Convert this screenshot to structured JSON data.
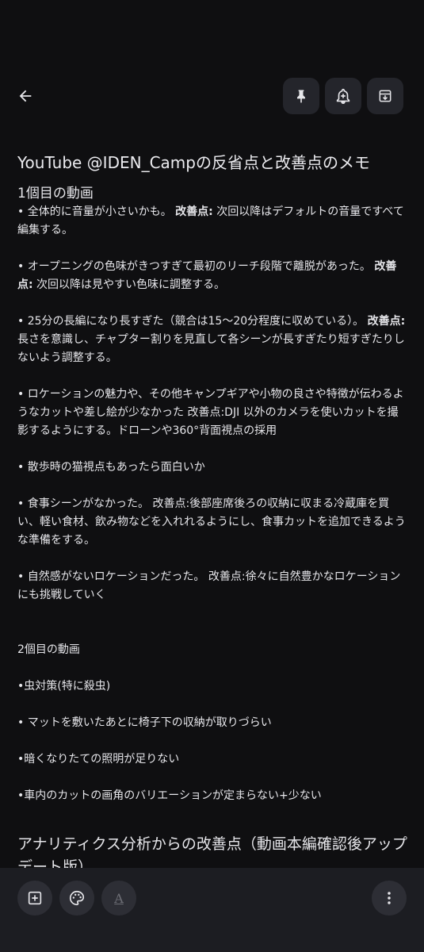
{
  "note": {
    "title": "YouTube @IDEN_Campの反省点と改善点のメモ",
    "section1": {
      "heading": "1個目の動画",
      "items": [
        {
          "text": "• 全体的に音量が小さいかも。 ",
          "bold": "改善点:",
          "after": " 次回以降はデフォルトの音量ですべて編集する。"
        },
        {
          "text": "• オープニングの色味がきつすぎて最初のリーチ段階で離脱があった。 ",
          "bold": "改善点:",
          "after": " 次回以降は見やすい色味に調整する。"
        },
        {
          "text": "• 25分の長編になり長すぎた（競合は15〜20分程度に収めている）。 ",
          "bold": "改善点:",
          "after": " 長さを意識し、チャプター割りを見直して各シーンが長すぎたり短すぎたりしないよう調整する。"
        },
        {
          "text": "• ロケーションの魅力や、その他キャンプギアや小物の良さや特徴が伝わるようなカットや差し絵が少なかった 改善点:DJI 以外のカメラを使いカットを撮影するようにする。ドローンや360°背面視点の採用"
        },
        {
          "text": "• 散歩時の猫視点もあったら面白いか"
        },
        {
          "text": "• 食事シーンがなかった。 改善点:後部座席後ろの収納に収まる冷蔵庫を買い、軽い食材、飲み物などを入れれるようにし、食事カットを追加できるような準備をする。"
        },
        {
          "text": "• 自然感がないロケーションだった。 改善点:徐々に自然豊かなロケーションにも挑戦していく"
        }
      ]
    },
    "section2": {
      "heading": "2個目の動画",
      "items": [
        "•虫対策(特に殺虫)",
        "• マットを敷いたあとに椅子下の収納が取りづらい",
        "•暗くなりたての照明が足りない",
        "•車内のカットの画角のバリエーションが定まらない+少ない"
      ]
    },
    "section3": {
      "heading": "アナリティクス分析からの改善点（動画本編確認後アップデート版）"
    }
  },
  "icons": {
    "back": "arrow-left-icon",
    "pin": "pin-icon",
    "reminder": "bell-plus-icon",
    "archive": "archive-icon",
    "add": "add-box-icon",
    "palette": "palette-icon",
    "format": "text-format-icon",
    "more": "more-vert-icon"
  },
  "colors": {
    "background": "#0f0f11",
    "text": "#e6e6ea",
    "button": "#24252b",
    "bottom_bar": "#1c1d22"
  }
}
